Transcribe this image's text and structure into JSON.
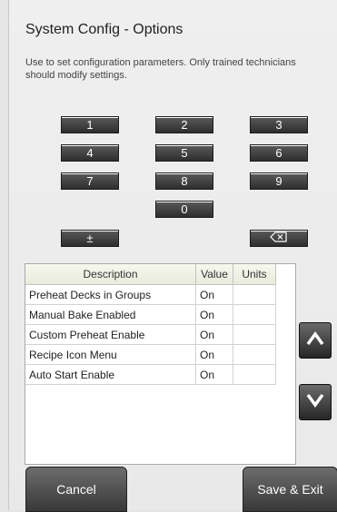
{
  "window": {
    "title": "System Config - Options"
  },
  "description_line1": "Use to set configuration parameters. Only trained technicians",
  "description_line2": "should modify settings.",
  "keypad": {
    "keys": [
      "1",
      "2",
      "3",
      "4",
      "5",
      "6",
      "7",
      "8",
      "9",
      "0"
    ],
    "plus_minus_label": "±",
    "backspace_icon": "backspace-icon"
  },
  "table": {
    "headers": [
      "Description",
      "Value",
      "Units"
    ],
    "rows": [
      {
        "description": "Preheat Decks in Groups",
        "value": "On",
        "units": ""
      },
      {
        "description": "Manual Bake Enabled",
        "value": "On",
        "units": ""
      },
      {
        "description": "Custom Preheat Enable",
        "value": "On",
        "units": ""
      },
      {
        "description": "Recipe Icon Menu",
        "value": "On",
        "units": ""
      },
      {
        "description": "Auto Start Enable",
        "value": "On",
        "units": ""
      }
    ]
  },
  "scroll": {
    "up_icon": "chevron-up-icon",
    "down_icon": "chevron-down-icon"
  },
  "buttons": {
    "cancel": "Cancel",
    "save_exit": "Save & Exit"
  },
  "colors": {
    "key_bg": "#3a3a3a",
    "screen_bg": "#eeeeee",
    "header_bg": "#f1f2e4"
  }
}
